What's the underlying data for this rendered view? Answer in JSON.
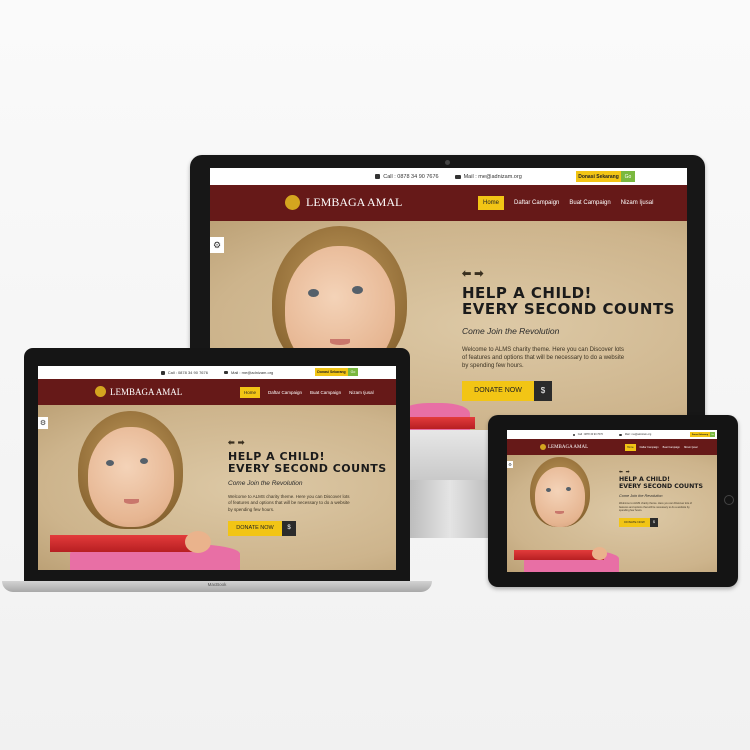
{
  "site": {
    "topbar": {
      "call": "Call : 0878 34 90 7676",
      "mail": "Mail : me@adnizam.org",
      "donate": "Donasi Sekarang",
      "donate_secondary": "Go"
    },
    "brand": "LEMBAGA AMAL",
    "nav": [
      "Home",
      "Daftar Campaign",
      "Buat Campaign",
      "Nizam Ijusal"
    ],
    "hero": {
      "arrows": [
        "⬅",
        "➡"
      ],
      "title_line1": "HELP A CHILD!",
      "title_line2": "EVERY SECOND COUNTS",
      "subtitle": "Come Join the Revolution",
      "description": "Welcome to ALMS charity theme. Here you can Discover lots of features and options that will be necessary to do a website by spending few hours.",
      "button": "DONATE NOW",
      "dollar": "$"
    }
  },
  "devices": {
    "laptop_brand": "MacBook"
  },
  "colors": {
    "nav_bg": "#661918",
    "accent": "#f2c515",
    "green": "#7ab83f",
    "dark": "#2b2b2b"
  },
  "icons": {
    "call": "phone-icon",
    "mail": "mail-icon",
    "settings": "gear-icon"
  }
}
